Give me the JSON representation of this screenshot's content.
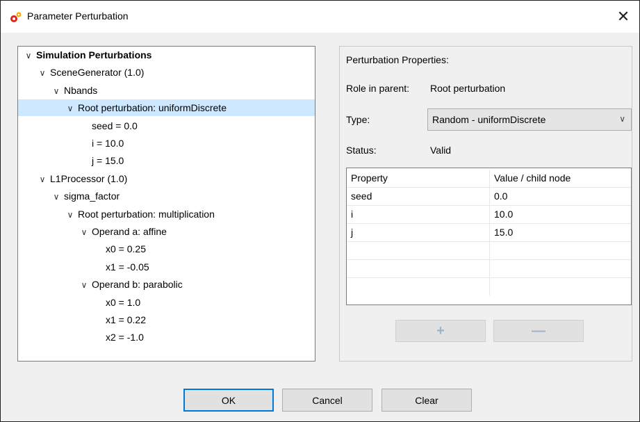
{
  "window": {
    "title": "Parameter Perturbation",
    "close_glyph": "✕",
    "icon": "gears-icon"
  },
  "tree": {
    "rows": [
      {
        "label": "Simulation Perturbations",
        "indent": 0,
        "chevron": "∨",
        "bold": true
      },
      {
        "label": "SceneGenerator (1.0)",
        "indent": 1,
        "chevron": "∨"
      },
      {
        "label": "Nbands",
        "indent": 2,
        "chevron": "∨"
      },
      {
        "label": "Root perturbation: uniformDiscrete",
        "indent": 3,
        "chevron": "∨",
        "selected": true
      },
      {
        "label": "seed = 0.0",
        "indent": 4,
        "chevron": ""
      },
      {
        "label": "i = 10.0",
        "indent": 4,
        "chevron": ""
      },
      {
        "label": "j = 15.0",
        "indent": 4,
        "chevron": ""
      },
      {
        "label": "L1Processor (1.0)",
        "indent": 1,
        "chevron": "∨"
      },
      {
        "label": "sigma_factor",
        "indent": 2,
        "chevron": "∨"
      },
      {
        "label": "Root perturbation: multiplication",
        "indent": 3,
        "chevron": "∨"
      },
      {
        "label": "Operand a: affine",
        "indent": 4,
        "chevron": "∨"
      },
      {
        "label": "x0 = 0.25",
        "indent": 5,
        "chevron": ""
      },
      {
        "label": "x1 = -0.05",
        "indent": 5,
        "chevron": ""
      },
      {
        "label": "Operand b: parabolic",
        "indent": 4,
        "chevron": "∨"
      },
      {
        "label": "x0 = 1.0",
        "indent": 5,
        "chevron": ""
      },
      {
        "label": "x1 = 0.22",
        "indent": 5,
        "chevron": ""
      },
      {
        "label": "x2 = -1.0",
        "indent": 5,
        "chevron": ""
      }
    ]
  },
  "properties": {
    "heading": "Perturbation Properties:",
    "role_label": "Role in parent:",
    "role_value": "Root perturbation",
    "type_label": "Type:",
    "type_value": "Random - uniformDiscrete",
    "status_label": "Status:",
    "status_value": "Valid",
    "table": {
      "headers": [
        "Property",
        "Value / child node"
      ],
      "rows": [
        [
          "seed",
          "0.0"
        ],
        [
          "i",
          "10.0"
        ],
        [
          "j",
          "15.0"
        ],
        [
          "",
          ""
        ],
        [
          "",
          ""
        ],
        [
          "",
          ""
        ]
      ]
    },
    "add_glyph": "+",
    "remove_glyph": "—"
  },
  "buttons": {
    "ok": "OK",
    "cancel": "Cancel",
    "clear": "Clear"
  }
}
